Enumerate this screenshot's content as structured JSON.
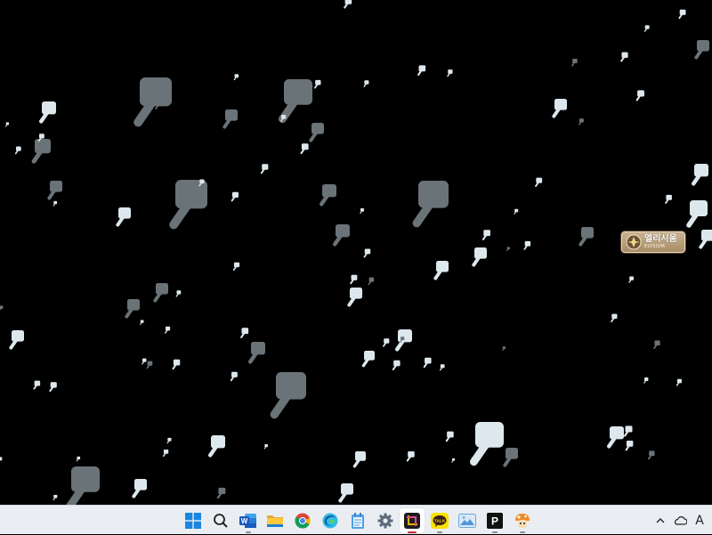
{
  "wallpaper": {
    "name": "snowfall-wallpaper",
    "background": "#000000",
    "flake_color": "#dce8ee"
  },
  "desktop_widget": {
    "icon": "elysium-emblem-icon",
    "title_kr": "엘리시움",
    "title_en": "ELYSIUM"
  },
  "taskbar": {
    "apps": [
      {
        "name": "start",
        "icon": "windows-start-icon",
        "running": false,
        "active": false
      },
      {
        "name": "search",
        "icon": "search-icon",
        "running": false,
        "active": false
      },
      {
        "name": "word",
        "icon": "word-icon",
        "running": true,
        "active": false
      },
      {
        "name": "file-explorer",
        "icon": "folder-icon",
        "running": false,
        "active": false
      },
      {
        "name": "chrome",
        "icon": "chrome-icon",
        "running": false,
        "active": false
      },
      {
        "name": "edge",
        "icon": "edge-icon",
        "running": false,
        "active": false
      },
      {
        "name": "notepad",
        "icon": "notepad-icon",
        "running": false,
        "active": false
      },
      {
        "name": "settings",
        "icon": "gear-icon",
        "running": false,
        "active": false
      },
      {
        "name": "snipping-tool",
        "icon": "crop-icon",
        "running": true,
        "active": true
      },
      {
        "name": "kakaotalk",
        "icon": "kakaotalk-icon",
        "running": true,
        "active": false
      },
      {
        "name": "photos",
        "icon": "photos-icon",
        "running": false,
        "active": false
      },
      {
        "name": "p-app",
        "icon": "p-logo-icon",
        "running": true,
        "active": false
      },
      {
        "name": "game-app",
        "icon": "mushroom-character-icon",
        "running": true,
        "active": false
      }
    ],
    "kakaotalk_label": "TALK",
    "p_app_label": "P",
    "tray": {
      "overflow_icon": "chevron-up-icon",
      "cloud_icon": "onedrive-cloud-icon",
      "ime_label": "A"
    }
  }
}
